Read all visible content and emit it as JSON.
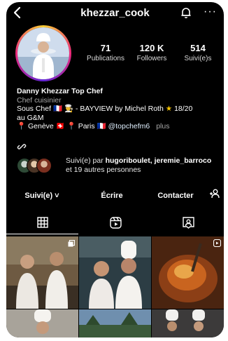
{
  "header": {
    "username": "khezzar_cook",
    "more_label": "···"
  },
  "stats": [
    {
      "value": "71",
      "label": "Publications"
    },
    {
      "value": "120 K",
      "label": "Followers"
    },
    {
      "value": "514",
      "label": "Suivi(e)s"
    }
  ],
  "bio": {
    "name": "Danny Khezzar Top Chef",
    "category": "Chef cuisinier",
    "line1_a": "Sous Chef",
    "line1_b": "- BAYVIEW by Michel Roth",
    "line1_c": "18/20",
    "line2": "au G&M",
    "loc_geneve": "Genève",
    "loc_paris": "Paris",
    "handle": "@topchefm6",
    "more": "plus"
  },
  "followed_by": {
    "prefix": "Suivi(e) par ",
    "names": "hugoriboulet, jeremie_barroco",
    "suffix": "et 19 autres personnes"
  },
  "actions": {
    "follow": "Suivi(e) ˅",
    "message": "Écrire",
    "contact": "Contacter"
  },
  "icons": {
    "back": "chevron-left-icon",
    "bell": "bell-icon",
    "link": "link-icon",
    "add_person": "add-person-icon",
    "grid": "grid-icon",
    "reels": "reels-icon",
    "tagged": "tagged-icon"
  },
  "colors": {
    "background": "#000000",
    "text": "#ffffff",
    "muted": "#a8a8a8",
    "story_ring": [
      "#f9ce34",
      "#ee2a7b",
      "#6228d7"
    ]
  },
  "posts": [
    {
      "scene": "two chefs in white jackets in a kitchen",
      "palette": [
        "#7d6a4f",
        "#e9e4dc",
        "#3a2f24"
      ]
    },
    {
      "scene": "two chefs in white toques posing",
      "palette": [
        "#2c3d44",
        "#f2f0ec",
        "#a97a57"
      ]
    },
    {
      "scene": "roasted meat dish close-up",
      "palette": [
        "#5a2a12",
        "#c9641f",
        "#e9a64a"
      ]
    },
    {
      "scene": "chef in toque",
      "palette": [
        "#a8a39a",
        "#f5f3ef",
        "#6b4e3a"
      ]
    },
    {
      "scene": "landscape with trees",
      "palette": [
        "#6f8fae",
        "#3b5a3a",
        "#cfd8e3"
      ]
    },
    {
      "scene": "chefs group photo",
      "palette": [
        "#3c3a3a",
        "#f2f0ee",
        "#8e6c55"
      ]
    }
  ]
}
